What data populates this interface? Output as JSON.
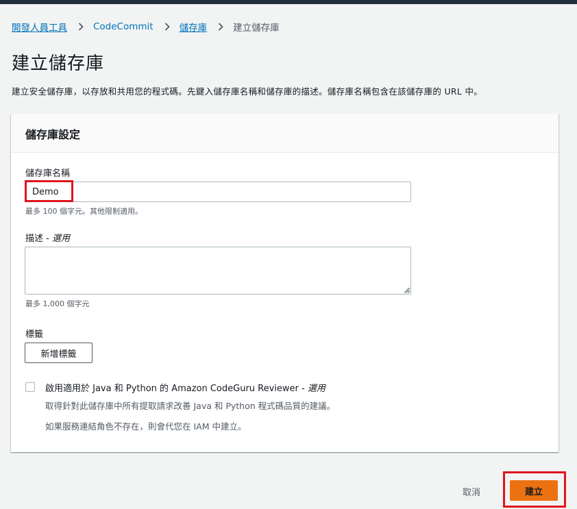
{
  "breadcrumb": {
    "items": [
      "開發人員工具",
      "CodeCommit",
      "儲存庫"
    ],
    "current": "建立儲存庫"
  },
  "page": {
    "title": "建立儲存庫",
    "description": "建立安全儲存庫，以存放和共用您的程式碼。先鍵入儲存庫名稱和儲存庫的描述。儲存庫名稱包含在該儲存庫的 URL 中。"
  },
  "panel": {
    "title": "儲存庫設定",
    "name_field": {
      "label": "儲存庫名稱",
      "value": "Demo",
      "hint": "最多 100 個字元。其他限制適用。"
    },
    "description_field": {
      "label": "描述 - ",
      "optional": "選用",
      "value": "",
      "hint": "最多 1,000 個字元"
    },
    "tags": {
      "label": "標籤",
      "add_button": "新增標籤"
    },
    "codeguru": {
      "label": "啟用適用於 Java 和 Python 的 Amazon CodeGuru Reviewer - ",
      "optional": "選用",
      "checked": false,
      "description_1": "取得針對此儲存庫中所有提取請求改善 Java 和 Python 程式碼品質的建議。",
      "description_2": "如果服務連結角色不存在，則會代您在 IAM 中建立。"
    }
  },
  "actions": {
    "cancel_label": "取消",
    "create_label": "建立"
  },
  "colors": {
    "link": "#0073bb",
    "primary_button": "#ec7211",
    "highlight": "#e0141e",
    "topbar": "#232f3e"
  }
}
